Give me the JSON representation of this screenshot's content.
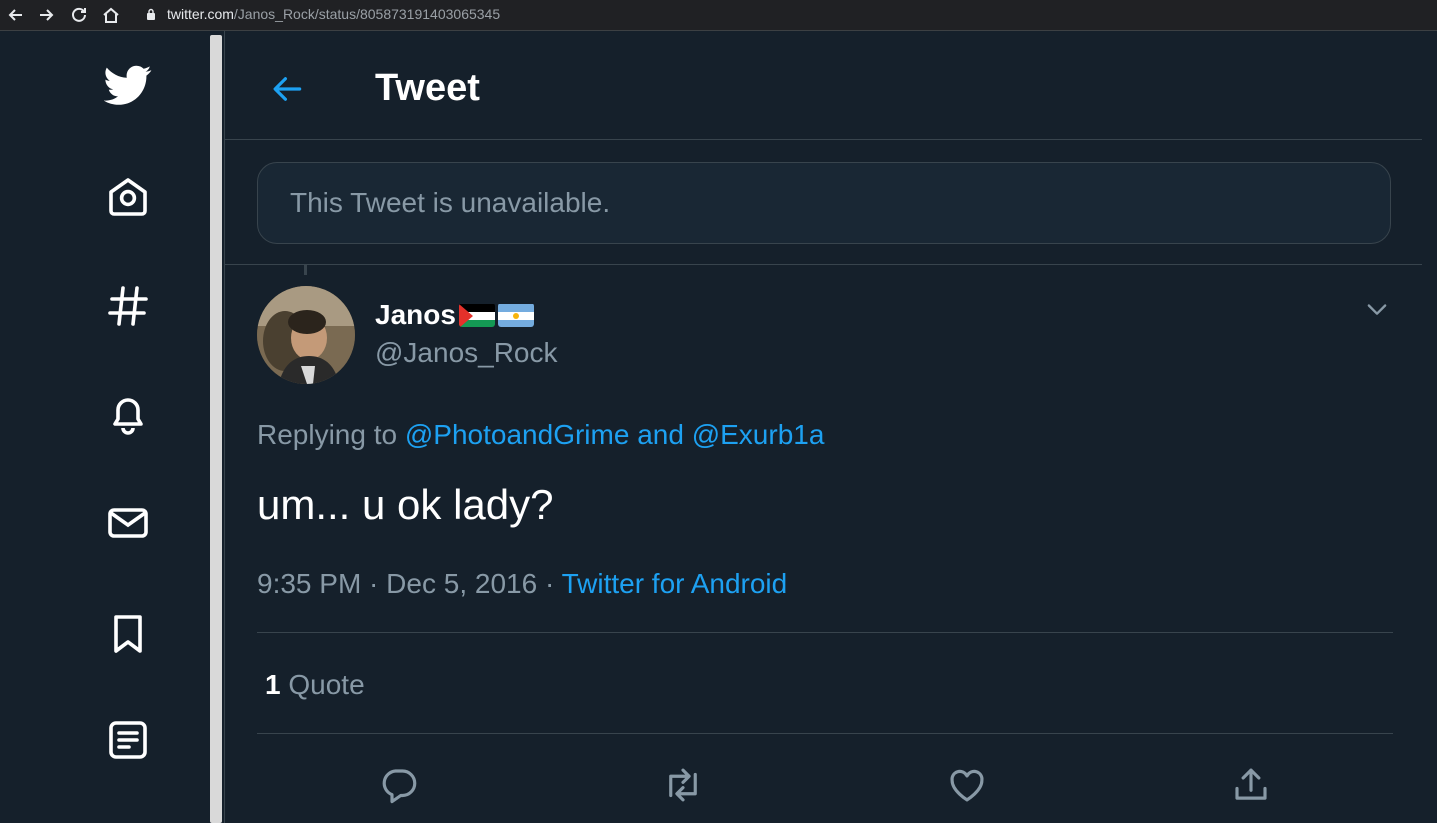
{
  "browser": {
    "url_domain": "twitter.com",
    "url_path": "/Janos_Rock/status/805873191403065345"
  },
  "sidebar": {
    "items": [
      {
        "icon": "twitter-logo-icon"
      },
      {
        "icon": "home-icon"
      },
      {
        "icon": "hashtag-icon"
      },
      {
        "icon": "bell-icon"
      },
      {
        "icon": "mail-icon"
      },
      {
        "icon": "bookmark-icon"
      },
      {
        "icon": "list-icon"
      }
    ]
  },
  "header": {
    "title": "Tweet"
  },
  "unavailable": {
    "text": "This Tweet is unavailable."
  },
  "tweet": {
    "display_name": "Janos",
    "handle": "@Janos_Rock",
    "replying_prefix": "Replying to ",
    "mention_1": "@PhotoandGrime",
    "mention_join": " and ",
    "mention_2": "@Exurb1a",
    "text": "um... u ok lady?",
    "time": "9:35 PM",
    "dot1": " · ",
    "date": "Dec 5, 2016",
    "dot2": " · ",
    "source": "Twitter for Android",
    "quote_count": "1",
    "quote_label": "Quote"
  },
  "colors": {
    "background": "#15202b",
    "accent": "#1da1f2",
    "muted": "#8899a6",
    "border": "#38444d"
  }
}
